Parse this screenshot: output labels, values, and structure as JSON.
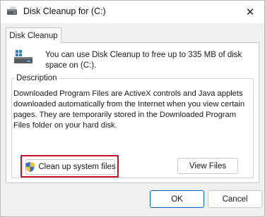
{
  "window": {
    "title": "Disk Cleanup for  (C:)",
    "close_glyph": "✕"
  },
  "tabs": [
    {
      "label": "Disk Cleanup",
      "active": true
    }
  ],
  "intro": {
    "text": "You can use Disk Cleanup to free up to 335 MB of disk space on  (C:)."
  },
  "description": {
    "label": "Description",
    "text": "Downloaded Program Files are ActiveX controls and Java applets downloaded automatically from the Internet when you view certain pages. They are temporarily stored in the Downloaded Program Files folder on your hard disk."
  },
  "buttons": {
    "clean_up_system_files": "Clean up system files",
    "view_files": "View Files",
    "ok": "OK",
    "cancel": "Cancel"
  },
  "icons": {
    "app": "disk-cleanup-icon",
    "drive": "drive-icon",
    "shield": "uac-shield-icon"
  },
  "colors": {
    "highlight_border": "#c8102e",
    "default_button_border": "#0067c0",
    "accent": "#0078d4"
  }
}
